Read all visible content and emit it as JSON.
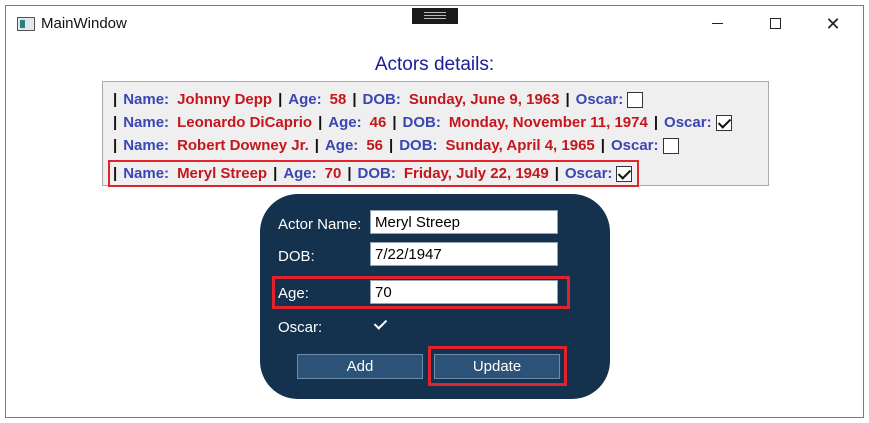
{
  "window": {
    "title": "MainWindow",
    "close_glyph": "✕"
  },
  "heading": "Actors details:",
  "labels": {
    "name": "Name:",
    "age": "Age:",
    "dob": "DOB:",
    "oscar": "Oscar:",
    "separator": "|"
  },
  "actors": [
    {
      "name": "Johnny Depp",
      "age": "58",
      "dob": "Sunday, June 9, 1963",
      "oscar": false
    },
    {
      "name": "Leonardo DiCaprio",
      "age": "46",
      "dob": "Monday, November 11, 1974",
      "oscar": true
    },
    {
      "name": "Robert Downey Jr.",
      "age": "56",
      "dob": "Sunday, April 4, 1965",
      "oscar": false
    },
    {
      "name": "Meryl Streep",
      "age": "70",
      "dob": "Friday, July 22, 1949",
      "oscar": true
    }
  ],
  "form": {
    "actor_name_label": "Actor Name:",
    "actor_name_value": "Meryl Streep",
    "dob_label": "DOB:",
    "dob_value": "7/22/1947",
    "age_label": "Age:",
    "age_value": "70",
    "oscar_label": "Oscar:",
    "oscar_checked": true,
    "add_label": "Add",
    "update_label": "Update"
  },
  "colors": {
    "label_blue": "#3a46b3",
    "value_red": "#c4161c",
    "panel_bg": "#14324e",
    "button_bg": "#2c5278",
    "highlight_red": "#e3232c"
  }
}
